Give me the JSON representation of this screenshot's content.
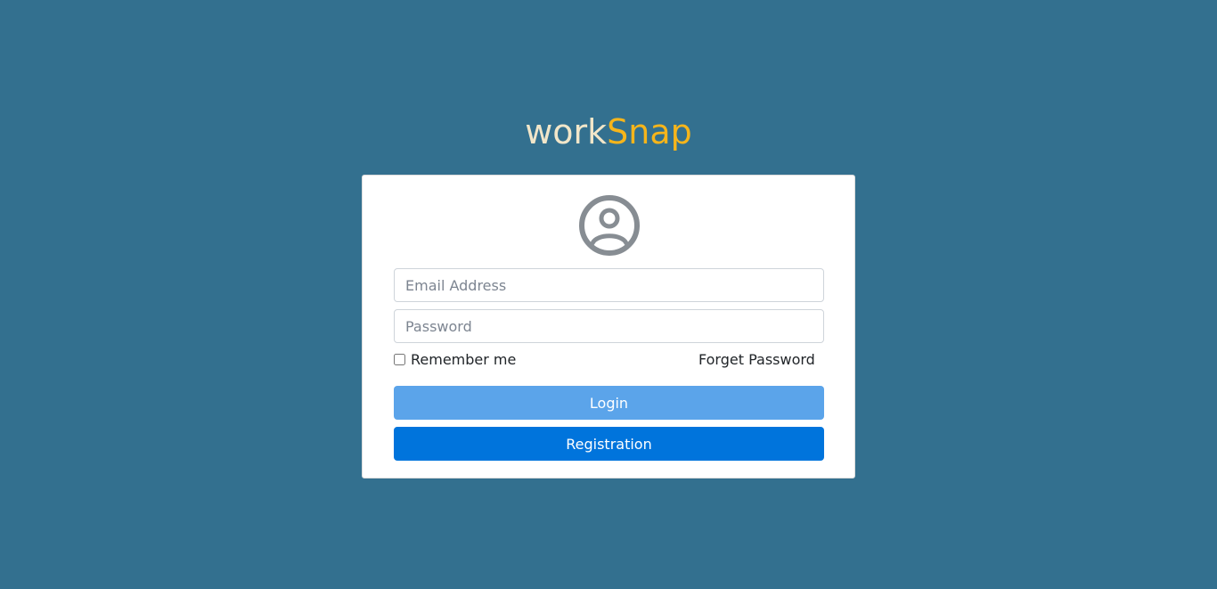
{
  "brand": {
    "part1": "work",
    "part2": "Snap",
    "color1": "#f1e6c9",
    "color2": "#f6b51b"
  },
  "login_form": {
    "avatar_icon": "user-circle-icon",
    "email_placeholder": "Email Address",
    "email_value": "",
    "password_placeholder": "Password",
    "password_value": "",
    "remember_label": "Remember me",
    "remember_checked": false,
    "forget_label": "Forget Password",
    "login_label": "Login",
    "registration_label": "Registration"
  },
  "colors": {
    "background": "#33708f",
    "login_button": "#5ba4ea",
    "registration_button": "#0074dc"
  }
}
